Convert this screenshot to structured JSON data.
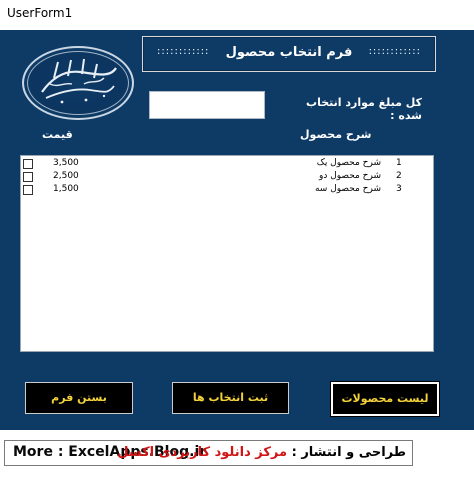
{
  "window": {
    "title": "UserForm1"
  },
  "header": {
    "title": "فرم انتخاب محصول",
    "dots": "::::::::::::"
  },
  "logo": {
    "text": "اللهم عجل لولیک الفرج"
  },
  "summary": {
    "label": "کل مبلغ موارد انتخاب شده :",
    "value": ""
  },
  "columns": {
    "price": "قیمت",
    "description": "شرح محصول"
  },
  "items": [
    {
      "num": "1",
      "description": "شرح محصول یک",
      "price": "3,500"
    },
    {
      "num": "2",
      "description": "شرح محصول دو",
      "price": "2,500"
    },
    {
      "num": "3",
      "description": "شرح محصول سه",
      "price": "1,500"
    }
  ],
  "buttons": {
    "close": "بستن فرم",
    "save": "ثبت انتخاب ها",
    "list": "لیست محصولات"
  },
  "footer": {
    "more": "More : ExcelApps.Blog.ir",
    "credit_prefix": "طراحی و انتشار :",
    "credit_name": "مرکز دانلود کاربردی اکسل"
  },
  "colors": {
    "form_bg": "#0e3a66",
    "button_bg": "#000000",
    "button_text": "#f4d33a",
    "credit_red": "#d01515"
  }
}
